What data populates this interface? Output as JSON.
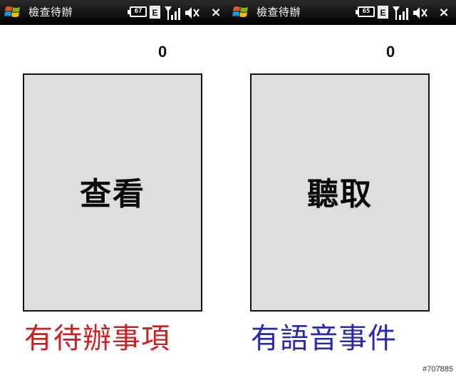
{
  "colors": {
    "titlebar_bg": "#000000",
    "panel_bg": "#dedede",
    "caption_left": "#cc2020",
    "caption_right": "#2828b0"
  },
  "panes": [
    {
      "title_bar": {
        "app_title": "檢查待辦",
        "start_icon": "windows-flag-icon",
        "battery_level": "67",
        "network_type": "E",
        "signal_icon": "signal-strength-icon",
        "volume_icon": "speaker-muted-icon",
        "close_label": "×"
      },
      "count": "0",
      "button_label": "查看",
      "caption": "有待辦事項"
    },
    {
      "title_bar": {
        "app_title": "檢查待辦",
        "start_icon": "windows-flag-icon",
        "battery_level": "65",
        "network_type": "E",
        "signal_icon": "signal-strength-icon",
        "volume_icon": "speaker-muted-icon",
        "close_label": "×"
      },
      "count": "0",
      "button_label": "聽取",
      "caption": "有語音事件"
    }
  ],
  "watermark": "#707885"
}
